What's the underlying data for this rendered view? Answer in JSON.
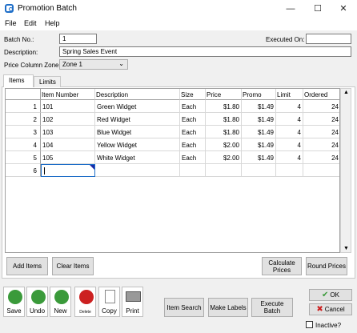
{
  "window": {
    "title": "Promotion Batch",
    "min": "—",
    "max": "☐",
    "close": "✕"
  },
  "menu": [
    "File",
    "Edit",
    "Help"
  ],
  "form": {
    "batch_label": "Batch No.:",
    "batch_value": "1",
    "executed_label": "Executed On:",
    "executed_value": "",
    "desc_label": "Description:",
    "desc_value": "Spring Sales Event",
    "zone_label": "Price Column Zone:",
    "zone_value": "Zone 1"
  },
  "tabs": [
    "Items",
    "Limits"
  ],
  "grid": {
    "headers": [
      "Item Number",
      "Description",
      "Size",
      "Price",
      "Promo",
      "Limit",
      "Ordered"
    ],
    "rows": [
      {
        "n": "1",
        "item": "101",
        "desc": "Green Widget",
        "size": "Each",
        "price": "$1.80",
        "promo": "$1.49",
        "limit": "4",
        "ordered": "24"
      },
      {
        "n": "2",
        "item": "102",
        "desc": "Red Widget",
        "size": "Each",
        "price": "$1.80",
        "promo": "$1.49",
        "limit": "4",
        "ordered": "24"
      },
      {
        "n": "3",
        "item": "103",
        "desc": "Blue Widget",
        "size": "Each",
        "price": "$1.80",
        "promo": "$1.49",
        "limit": "4",
        "ordered": "24"
      },
      {
        "n": "4",
        "item": "104",
        "desc": "Yellow Widget",
        "size": "Each",
        "price": "$2.00",
        "promo": "$1.49",
        "limit": "4",
        "ordered": "24"
      },
      {
        "n": "5",
        "item": "105",
        "desc": "White Widget",
        "size": "Each",
        "price": "$2.00",
        "promo": "$1.49",
        "limit": "4",
        "ordered": "24"
      },
      {
        "n": "6",
        "item": "",
        "desc": "",
        "size": "",
        "price": "",
        "promo": "",
        "limit": "",
        "ordered": ""
      }
    ]
  },
  "panel_buttons": {
    "add_items": "Add Items",
    "clear_items": "Clear Items",
    "calc_prices": "Calculate Prices",
    "round_prices": "Round Prices"
  },
  "toolbar": {
    "save": "Save",
    "undo": "Undo",
    "new": "New",
    "delete": "Delete",
    "copy": "Copy",
    "print": "Print",
    "item_search": "Item Search",
    "make_labels": "Make Labels",
    "execute_batch": "Execute Batch",
    "ok": "OK",
    "cancel": "Cancel",
    "inactive": "Inactive?"
  },
  "colors": {
    "green": "#3a9a3a",
    "red": "#cc2020",
    "blue": "#1e6ec8"
  }
}
